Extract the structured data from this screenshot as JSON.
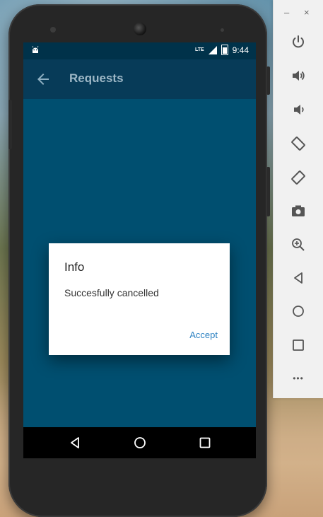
{
  "status_bar": {
    "time": "9:44",
    "network": "LTE"
  },
  "app_bar": {
    "title": "Requests"
  },
  "dialog": {
    "title": "Info",
    "message": "Succesfully cancelled",
    "accept_label": "Accept"
  },
  "toolbar": {
    "minimize_label": "–",
    "close_label": "×",
    "more_label": "•••"
  },
  "colors": {
    "app_bar": "#073b58",
    "content_bg": "#004f70",
    "accent": "#2f83c3"
  },
  "icons": [
    "power-icon",
    "volume-up-icon",
    "volume-down-icon",
    "rotate-left-icon",
    "rotate-right-icon",
    "camera-icon",
    "zoom-in-icon",
    "back-icon",
    "home-icon",
    "overview-icon",
    "more-icon"
  ]
}
